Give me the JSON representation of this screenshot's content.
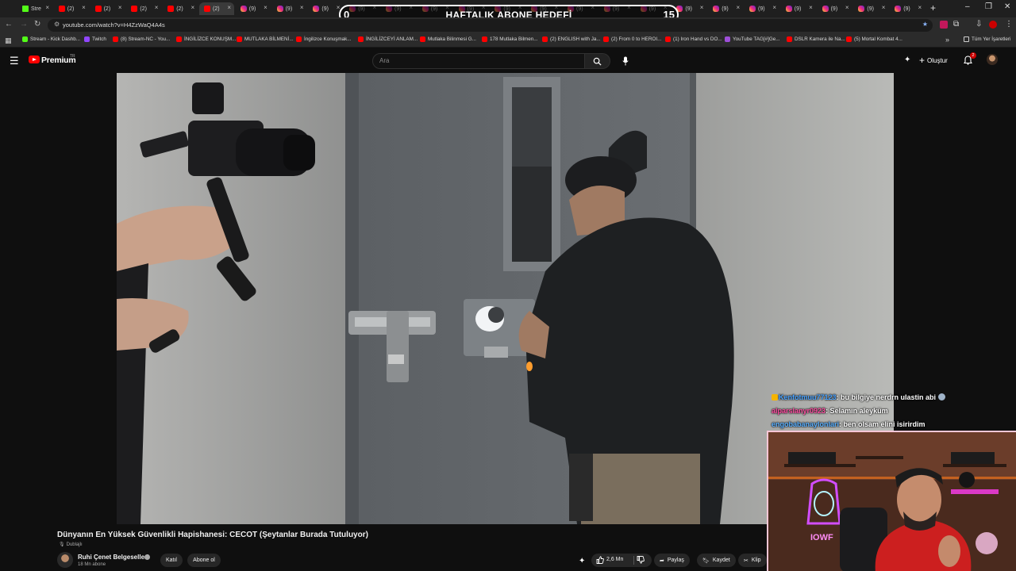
{
  "browser": {
    "tabs": [
      {
        "label": "Stre",
        "favicon": "kick-icon"
      },
      {
        "label": "(2)",
        "favicon": "youtube-icon"
      },
      {
        "label": "(2)",
        "favicon": "youtube-icon"
      },
      {
        "label": "(2)",
        "favicon": "youtube-icon"
      },
      {
        "label": "(2)",
        "favicon": "youtube-icon"
      },
      {
        "label": "(2)",
        "favicon": "youtube-icon",
        "active": true
      },
      {
        "label": "(9)",
        "favicon": "instagram-icon"
      },
      {
        "label": "(9)",
        "favicon": "instagram-icon"
      },
      {
        "label": "(9)",
        "favicon": "instagram-icon"
      },
      {
        "label": "(9)",
        "favicon": "instagram-icon"
      },
      {
        "label": "(9)",
        "favicon": "instagram-icon"
      },
      {
        "label": "(9)",
        "favicon": "instagram-icon"
      },
      {
        "label": "(9)",
        "favicon": "instagram-icon"
      },
      {
        "label": "(9)",
        "favicon": "instagram-icon"
      },
      {
        "label": "(9)",
        "favicon": "instagram-icon"
      },
      {
        "label": "(9)",
        "favicon": "instagram-icon"
      },
      {
        "label": "(9)",
        "favicon": "instagram-icon"
      },
      {
        "label": "(9)",
        "favicon": "instagram-icon"
      },
      {
        "label": "(9)",
        "favicon": "instagram-icon"
      },
      {
        "label": "(9)",
        "favicon": "instagram-icon"
      },
      {
        "label": "(9)",
        "favicon": "instagram-icon"
      },
      {
        "label": "(9)",
        "favicon": "instagram-icon"
      },
      {
        "label": "(9)",
        "favicon": "instagram-icon"
      },
      {
        "label": "(9)",
        "favicon": "instagram-icon"
      },
      {
        "label": "(9)",
        "favicon": "instagram-icon"
      }
    ],
    "url": "youtube.com/watch?v=H4ZzWaQ4A4s",
    "bookmarks": [
      {
        "label": "Stream - Kick Dashb...",
        "favicon": "kick"
      },
      {
        "label": "Twitch",
        "favicon": "twitch"
      },
      {
        "label": "(8) Stream-NC - You...",
        "favicon": "yt"
      },
      {
        "label": "İNGİLİZCE KONUŞM...",
        "favicon": "yt"
      },
      {
        "label": "MUTLAKA BİLMENİ...",
        "favicon": "yt"
      },
      {
        "label": "İngilizce Konuşmak...",
        "favicon": "yt"
      },
      {
        "label": "İNGİLİZCEYİ ANLAM...",
        "favicon": "yt"
      },
      {
        "label": "Mutlaka Bilinmesi G...",
        "favicon": "yt"
      },
      {
        "label": "178 Mutlaka Bilmen...",
        "favicon": "yt"
      },
      {
        "label": "(2) ENGLISH with Ja...",
        "favicon": "yt"
      },
      {
        "label": "(2) From 0 to HEROI...",
        "favicon": "yt"
      },
      {
        "label": "(1) Iron Hand vs DO...",
        "favicon": "yt"
      },
      {
        "label": "YouTube TAG[#]Ge...",
        "favicon": "other"
      },
      {
        "label": "DSLR Kamera ile Na...",
        "favicon": "yt"
      },
      {
        "label": "(5) Mortal Kombat 4...",
        "favicon": "yt"
      }
    ],
    "all_bookmarks": "Tüm Yer İşaretleri"
  },
  "goal_overlay": {
    "start": "0",
    "title": "HAFTALIK ABONE HEDEFİ",
    "end": "15"
  },
  "youtube": {
    "brand": "Premium",
    "country": "TR",
    "search_placeholder": "Ara",
    "create_label": "Oluştur",
    "notification_count": "2",
    "video_title": "Dünyanın En Yüksek Güvenlikli Hapishanesi: CECOT (Şeytanlar Burada Tutuluyor)",
    "dubbed_label": "Dublajlı",
    "channel_name": "Ruhi Çenet Belgeselleri",
    "subscriber_count": "18 Mn abone",
    "join_label": "Katıl",
    "subscribe_label": "Abone ol",
    "like_count": "2,6 Mn",
    "share_label": "Paylaş",
    "save_label": "Kaydet",
    "clip_label": "Klip"
  },
  "stream_chat": [
    {
      "user": "Kenfotmuu77123",
      "user_color": "#4aa3ff",
      "message": ": bu bilgiye nerdrn ulastin abi"
    },
    {
      "user": "alparslanyr0923",
      "user_color": "#ff4fa3",
      "message": ": Selamın aleyküm"
    },
    {
      "user": "engobabanaylonlari",
      "user_color": "#5ab0ff",
      "message": ": ben olsam elini isirirdim"
    }
  ],
  "webcam_overlay": {
    "neon_sign": "IOWF"
  },
  "colors": {
    "youtube_red": "#ff0000",
    "background": "#0f0f0f",
    "goal_border": "#ffffff"
  }
}
